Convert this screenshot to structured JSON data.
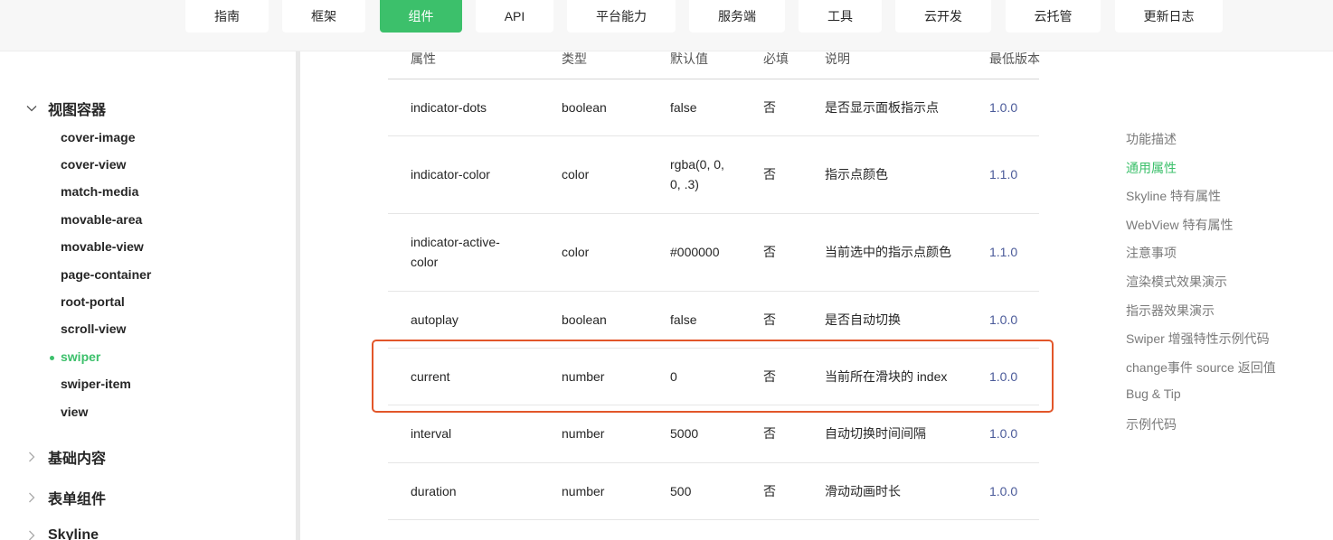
{
  "nav": [
    {
      "label": "指南"
    },
    {
      "label": "框架"
    },
    {
      "label": "组件",
      "active": true
    },
    {
      "label": "API"
    },
    {
      "label": "平台能力"
    },
    {
      "label": "服务端"
    },
    {
      "label": "工具"
    },
    {
      "label": "云开发"
    },
    {
      "label": "云托管"
    },
    {
      "label": "更新日志"
    }
  ],
  "sidebar": {
    "groups": [
      {
        "label": "视图容器",
        "expanded": true
      },
      {
        "label": "基础内容",
        "expanded": false
      },
      {
        "label": "表单组件",
        "expanded": false
      },
      {
        "label": "Skyline",
        "expanded": false
      }
    ],
    "items": [
      {
        "label": "cover-image"
      },
      {
        "label": "cover-view"
      },
      {
        "label": "match-media"
      },
      {
        "label": "movable-area"
      },
      {
        "label": "movable-view"
      },
      {
        "label": "page-container"
      },
      {
        "label": "root-portal"
      },
      {
        "label": "scroll-view"
      },
      {
        "label": "swiper",
        "active": true
      },
      {
        "label": "swiper-item"
      },
      {
        "label": "view"
      }
    ]
  },
  "table": {
    "headers": [
      "属性",
      "类型",
      "默认值",
      "必填",
      "说明",
      "最低版本"
    ],
    "rows": [
      {
        "attr": "indicator-dots",
        "type": "boolean",
        "default": "false",
        "required": "否",
        "desc": "是否显示面板指示点",
        "version": "1.0.0"
      },
      {
        "attr": "indicator-color",
        "type": "color",
        "default": [
          "rgba(0, 0,",
          "0, .3)"
        ],
        "required": "否",
        "desc": "指示点颜色",
        "version": "1.1.0"
      },
      {
        "attr": [
          "indicator-active-",
          "color"
        ],
        "type": "color",
        "default": "#000000",
        "required": "否",
        "desc": "当前选中的指示点颜色",
        "version": "1.1.0"
      },
      {
        "attr": "autoplay",
        "type": "boolean",
        "default": "false",
        "required": "否",
        "desc": "是否自动切换",
        "version": "1.0.0"
      },
      {
        "attr": "current",
        "type": "number",
        "default": "0",
        "required": "否",
        "desc": "当前所在滑块的 index",
        "version": "1.0.0",
        "highlighted": true
      },
      {
        "attr": "interval",
        "type": "number",
        "default": "5000",
        "required": "否",
        "desc": "自动切换时间间隔",
        "version": "1.0.0"
      },
      {
        "attr": "duration",
        "type": "number",
        "default": "500",
        "required": "否",
        "desc": "滑动动画时长",
        "version": "1.0.0"
      }
    ]
  },
  "toc": [
    {
      "label": "功能描述"
    },
    {
      "label": "通用属性",
      "active": true
    },
    {
      "label": "Skyline 特有属性"
    },
    {
      "label": "WebView 特有属性"
    },
    {
      "label": "注意事项"
    },
    {
      "label": "渲染模式效果演示"
    },
    {
      "label": "指示器效果演示"
    },
    {
      "label": "Swiper 增强特性示例代码"
    },
    {
      "label": "change事件 source 返回值"
    },
    {
      "label": "Bug & Tip"
    },
    {
      "label": "示例代码"
    }
  ],
  "colors": {
    "accent": "#3cc06b",
    "highlight_border": "#e2562a",
    "version_link": "#4a5a99"
  }
}
